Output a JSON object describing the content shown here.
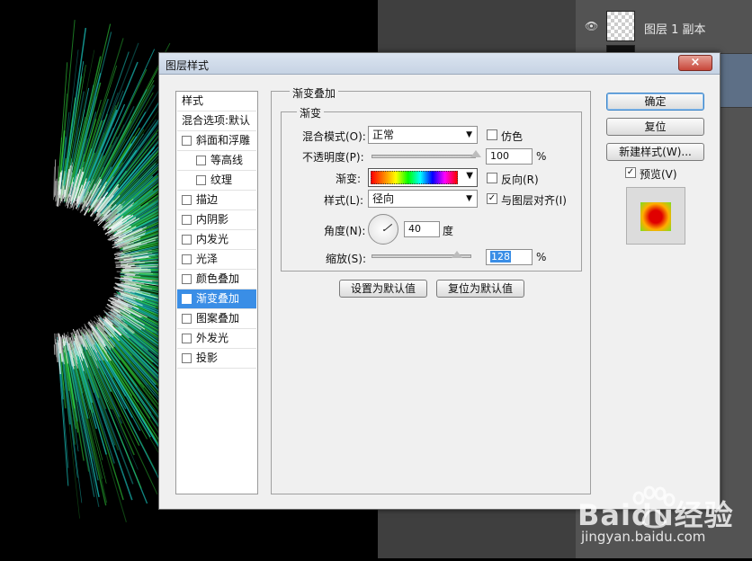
{
  "layers_panel": {
    "layers": [
      {
        "name": "图层 1 副本"
      }
    ]
  },
  "dialog": {
    "title": "图层样式",
    "close_label": "×",
    "styles_header": "样式",
    "blend_options": "混合选项:默认",
    "style_items": [
      {
        "label": "斜面和浮雕",
        "checked": false
      },
      {
        "label": "等高线",
        "checked": false
      },
      {
        "label": "纹理",
        "checked": false
      },
      {
        "label": "描边",
        "checked": false
      },
      {
        "label": "内阴影",
        "checked": false
      },
      {
        "label": "内发光",
        "checked": false
      },
      {
        "label": "光泽",
        "checked": false
      },
      {
        "label": "颜色叠加",
        "checked": false
      },
      {
        "label": "渐变叠加",
        "checked": true,
        "selected": true
      },
      {
        "label": "图案叠加",
        "checked": false
      },
      {
        "label": "外发光",
        "checked": false
      },
      {
        "label": "投影",
        "checked": false
      }
    ],
    "section_title": "渐变叠加",
    "group_title": "渐变",
    "blend_mode_label": "混合模式(O):",
    "blend_mode_value": "正常",
    "dither_label": "仿色",
    "dither_checked": false,
    "opacity_label": "不透明度(P):",
    "opacity_value": "100",
    "opacity_level": 100,
    "percent": "%",
    "gradient_label": "渐变:",
    "reverse_label": "反向(R)",
    "reverse_checked": false,
    "style_label": "样式(L):",
    "style_value": "径向",
    "align_label": "与图层对齐(I)",
    "align_checked": true,
    "angle_label": "角度(N):",
    "angle_value": "40",
    "angle_unit": "度",
    "scale_label": "缩放(S):",
    "scale_value": "128",
    "scale_level": 128,
    "set_default_label": "设置为默认值",
    "reset_default_label": "复位为默认值",
    "ok_label": "确定",
    "reset_label": "复位",
    "new_style_label": "新建样式(W)...",
    "preview_label": "预览(V)",
    "preview_checked": true
  },
  "watermark": {
    "brand": "Baidu经验",
    "url": "jingyan.baidu.com"
  },
  "colors": {
    "selection": "#3a8ee6",
    "burst_green": "#2fcf3a",
    "burst_cyan": "#19c6c0"
  },
  "icons": {
    "eye": "eye-icon",
    "dropdown": "chevron-down-icon",
    "check": "checkmark-icon",
    "angle_dial": "angle-dial-icon"
  }
}
